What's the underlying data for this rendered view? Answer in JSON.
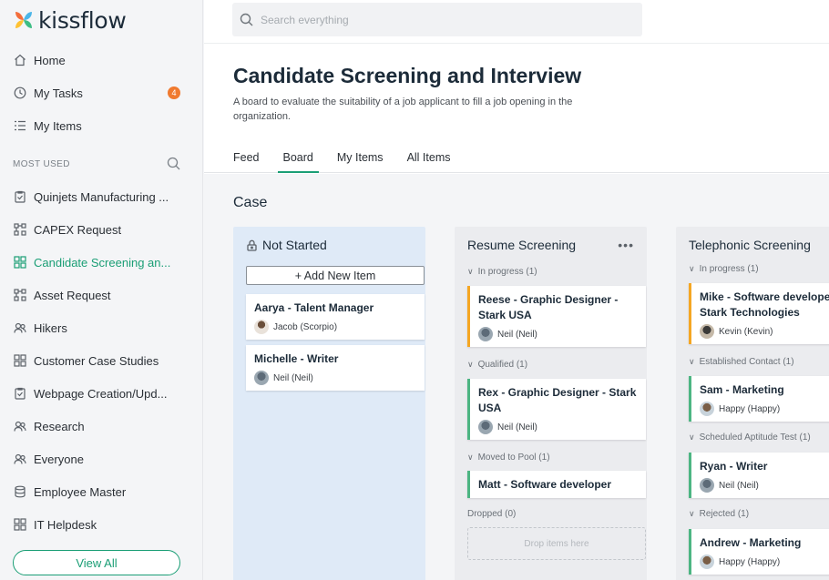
{
  "brand": {
    "name": "kissflow"
  },
  "sidebar": {
    "nav": [
      {
        "label": "Home",
        "icon": "home-icon"
      },
      {
        "label": "My Tasks",
        "icon": "clock-icon",
        "badge": "4"
      },
      {
        "label": "My Items",
        "icon": "list-icon"
      }
    ],
    "section_label": "MOST USED",
    "items": [
      {
        "label": "Quinjets Manufacturing ...",
        "icon": "clipboard-icon"
      },
      {
        "label": "CAPEX Request",
        "icon": "flow-icon"
      },
      {
        "label": "Candidate Screening an...",
        "icon": "board-icon"
      },
      {
        "label": "Asset Request",
        "icon": "flow-icon"
      },
      {
        "label": "Hikers",
        "icon": "people-icon"
      },
      {
        "label": "Customer Case Studies",
        "icon": "board-icon"
      },
      {
        "label": "Webpage Creation/Upd...",
        "icon": "clipboard-icon"
      },
      {
        "label": "Research",
        "icon": "people-icon"
      },
      {
        "label": "Everyone",
        "icon": "people-icon"
      },
      {
        "label": "Employee Master",
        "icon": "database-icon"
      },
      {
        "label": "IT Helpdesk",
        "icon": "board-icon"
      }
    ],
    "view_all": "View All"
  },
  "search": {
    "placeholder": "Search everything"
  },
  "page": {
    "title": "Candidate Screening and Interview",
    "description": "A board to evaluate the suitability of a job applicant to fill a job opening in the organization.",
    "tabs": [
      "Feed",
      "Board",
      "My Items",
      "All Items"
    ],
    "active_tab": "Board"
  },
  "board": {
    "section_title": "Case",
    "add_new": "+ Add New Item",
    "columns": [
      {
        "title": "Not Started",
        "cards": [
          {
            "title": "Aarya - Talent Manager",
            "user": "Jacob (Scorpio)"
          },
          {
            "title": "Michelle - Writer",
            "user": "Neil (Neil)"
          }
        ]
      },
      {
        "title": "Resume Screening",
        "groups": [
          {
            "label": "In progress (1)",
            "cards": [
              {
                "title": "Reese - Graphic Designer - Stark USA",
                "user": "Neil (Neil)"
              }
            ]
          },
          {
            "label": "Qualified (1)",
            "cards": [
              {
                "title": "Rex - Graphic Designer - Stark USA",
                "user": "Neil (Neil)"
              }
            ]
          },
          {
            "label": "Moved to Pool (1)",
            "cards": [
              {
                "title": "Matt - Software developer"
              }
            ]
          },
          {
            "label": "Dropped (0)",
            "drop_text": "Drop items here"
          }
        ]
      },
      {
        "title": "Telephonic Screening",
        "groups": [
          {
            "label": "In progress (1)",
            "cards": [
              {
                "title": "Mike - Software developer - Stark Technologies",
                "user": "Kevin (Kevin)"
              }
            ]
          },
          {
            "label": "Established Contact (1)",
            "cards": [
              {
                "title": "Sam - Marketing",
                "user": "Happy (Happy)"
              }
            ]
          },
          {
            "label": "Scheduled Aptitude Test (1)",
            "cards": [
              {
                "title": "Ryan - Writer",
                "user": "Neil (Neil)"
              }
            ]
          },
          {
            "label": "Rejected (1)",
            "cards": [
              {
                "title": "Andrew - Marketing",
                "user": "Happy (Happy)"
              }
            ]
          }
        ]
      }
    ]
  },
  "colors": {
    "accent": "#1a9e75",
    "badge": "#f07a2f",
    "orange_accent": "#f5a623",
    "green_accent": "#4cb582"
  }
}
